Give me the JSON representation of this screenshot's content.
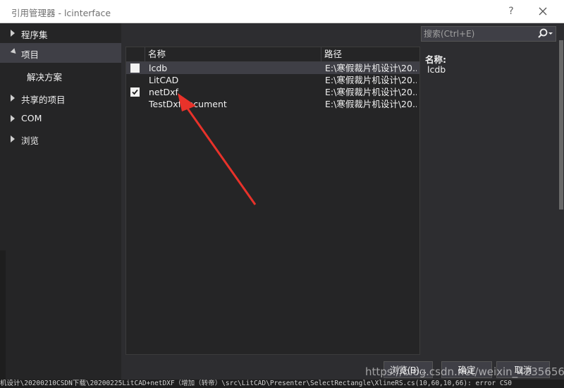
{
  "window": {
    "title": "引用管理器 - lcinterface",
    "help": "?"
  },
  "nav": {
    "items": [
      {
        "label": "程序集",
        "expanded": false
      },
      {
        "label": "项目",
        "expanded": true
      },
      {
        "label": "解决方案",
        "sub": true
      },
      {
        "label": "共享的项目",
        "expanded": false
      },
      {
        "label": "COM",
        "expanded": false
      },
      {
        "label": "浏览",
        "expanded": false
      }
    ]
  },
  "table": {
    "headers": {
      "name": "名称",
      "path": "路径"
    },
    "rows": [
      {
        "name": "lcdb",
        "path": "E:\\寒假裁片机设计\\20...",
        "checked": false,
        "selected": true
      },
      {
        "name": "LitCAD",
        "path": "E:\\寒假裁片机设计\\20...",
        "checked": null,
        "selected": false
      },
      {
        "name": "netDxf",
        "path": "E:\\寒假裁片机设计\\20...",
        "checked": true,
        "selected": false
      },
      {
        "name": "TestDxfDocument",
        "path": "E:\\寒假裁片机设计\\20...",
        "checked": null,
        "selected": false
      }
    ]
  },
  "search": {
    "placeholder": "搜索(Ctrl+E)",
    "value": ""
  },
  "details": {
    "label": "名称:",
    "value": "lcdb"
  },
  "buttons": {
    "browse": "浏览(B)...",
    "ok": "确定",
    "cancel": "取消"
  },
  "background": {
    "status_line": "机设计\\20200210CSDN下载\\20200225LitCAD+netDXF（增加（转帝）\\src\\LitCAD\\Presenter\\SelectRectangle\\XlineRS.cs(10,60,10,66): error CS0"
  },
  "watermark": "https://blog.csdn.net/weixin_42356569",
  "colors": {
    "accent_arrow": "#e8322a",
    "dialog_bg": "#2d2d30",
    "panel_bg": "#252526",
    "selected_bg": "#3f3f46"
  }
}
